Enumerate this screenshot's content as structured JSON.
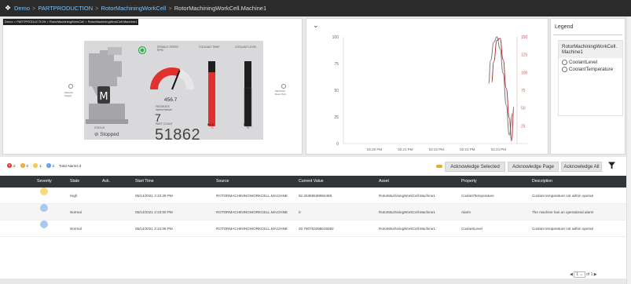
{
  "breadcrumb": {
    "items": [
      "Demo",
      "PARTPRODUCTION",
      "RotorMachiningWorkCell",
      "RotorMachiningWorkCell.Machine1"
    ],
    "separator": ">"
  },
  "machine_panel": {
    "mini_breadcrumb": "Demo > PARTPRODUCTION > RotorMachiningWorkCell > RotorMachiningWorkCell.Machine1",
    "spindle_speed_label": "SPINDLE SPEED",
    "spindle_speed_unit": "RPM",
    "spindle_speed_value": "456.7",
    "spindle_speed_fraction": 0.62,
    "feedrate_label": "FEEDRATE",
    "feedrate_unit": "inches/minute",
    "feedrate_value": "7",
    "part_count_label": "PART COUNT",
    "part_count_value": "51862",
    "status_label": "STATUS",
    "status_value": "Stopped",
    "coolant_temp_label": "COOLANT TEMP",
    "coolant_temp_unit": "°C",
    "coolant_temp_value": "91.3",
    "coolant_temp_fraction": 0.83,
    "coolant_level_label": "COOLANT LEVEL",
    "coolant_level_unit": "%",
    "coolant_level_value": "58.8",
    "coolant_level_fraction": 0.59,
    "input_port_label": "Material Supply",
    "output_port_label": "Machined Rotor Part"
  },
  "chart_data": {
    "type": "line",
    "title": "",
    "xlabel": "",
    "ylabel": "",
    "x_ticks": [
      "02:20 PM",
      "02:21 PM",
      "02:22 PM",
      "02:23 PM",
      "02:24 PM"
    ],
    "y_ticks_left": [
      0,
      25,
      50,
      75,
      100
    ],
    "y_ticks_right": [
      25,
      50,
      75,
      100,
      125,
      150
    ],
    "ylim_left": [
      0,
      100
    ],
    "ylim_right": [
      0,
      150
    ],
    "grid": false,
    "series": [
      {
        "name": "CoolantLevel",
        "axis": "left",
        "color": "#7a7a7a",
        "x": [
          4.68,
          4.75,
          4.85,
          4.95,
          5.05,
          5.15,
          5.25,
          5.35,
          5.45
        ],
        "values": [
          56,
          78,
          95,
          100,
          89,
          66,
          36,
          8,
          28
        ]
      },
      {
        "name": "CoolantTemperature",
        "axis": "right",
        "color": "#b03a3a",
        "x": [
          4.78,
          4.85,
          4.95,
          5.05,
          5.15,
          5.25,
          5.35,
          5.42,
          5.5
        ],
        "values": [
          86,
          115,
          145,
          148,
          118,
          78,
          36,
          4,
          52
        ]
      }
    ]
  },
  "legend": {
    "title": "Legend",
    "group": "RotorMachiningWorkCell.Machine1",
    "items": [
      "CoolantLevel",
      "CoolantTemperature"
    ]
  },
  "alarm_summary": {
    "counts": [
      {
        "value": "2",
        "color": "#e0312e"
      },
      {
        "value": "0",
        "color": "#ecaa2d"
      },
      {
        "value": "1",
        "color": "#f6c744"
      },
      {
        "value": "2",
        "color": "#5a9de0"
      }
    ],
    "total_label": "Total Alarms:3"
  },
  "toolbar": {
    "ack_selected": "Acknowledge Selected",
    "ack_page": "Acknowledge Page",
    "ack_all": "Acknowledge All"
  },
  "table": {
    "columns": [
      "Severity",
      "State",
      "Ack.",
      "Start Time",
      "Source",
      "Current Value",
      "Asset",
      "Property",
      "Description"
    ],
    "rows": [
      {
        "severity_color": "#f6d97a",
        "state": "High",
        "ack": "",
        "start_time": "05/14/2021 2:23:28 PM",
        "source": "ROTORMACHININGWORKCELL.MACHINE",
        "current_value": "92.25385539994488",
        "asset": "RotorMachiningWorkCell.Machine1",
        "property": "CoolantTemperature",
        "description": "Coolant temperature not within operati"
      },
      {
        "severity_color": "#a9c8f0",
        "state": "Normal",
        "ack": "",
        "start_time": "05/14/2021 2:23:00 PM",
        "source": "ROTORMACHININGWORKCELL.MACHINE",
        "current_value": "0",
        "asset": "RotorMachiningWorkCell.Machine1",
        "property": "Alarm",
        "description": "The machine has an operational alarm"
      },
      {
        "severity_color": "#a9c8f0",
        "state": "Normal",
        "ack": "",
        "start_time": "05/14/2021 2:24:05 PM",
        "source": "ROTORMACHININGWORKCELL.MACHINE",
        "current_value": "20.760763296016082",
        "asset": "RotorMachiningWorkCell.Machine1",
        "property": "CoolantLevel",
        "description": "Coolant temperature not within operati"
      }
    ]
  },
  "pager": {
    "page": "1",
    "of_label": "of 1"
  }
}
